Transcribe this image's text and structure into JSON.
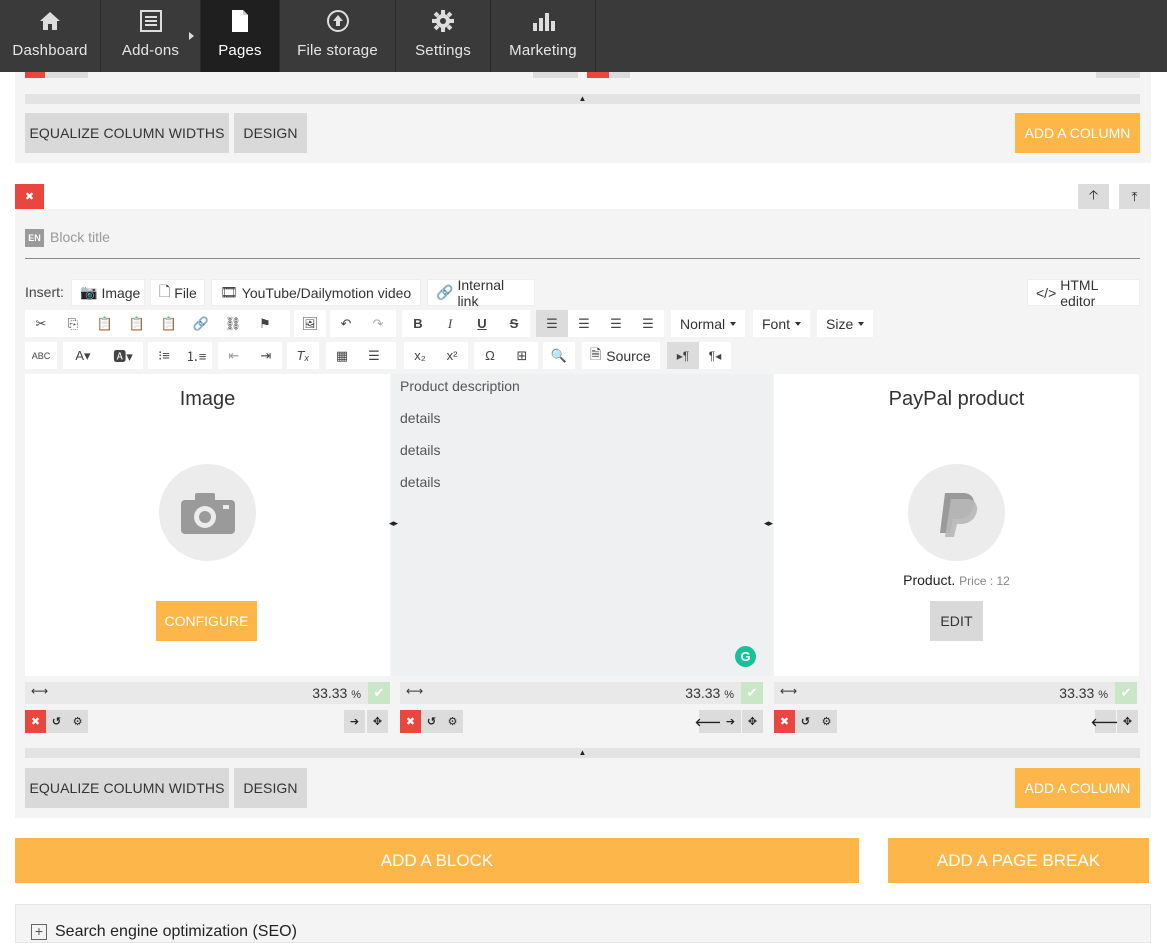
{
  "nav": {
    "dashboard": "Dashboard",
    "addons": "Add-ons",
    "pages": "Pages",
    "file_storage": "File storage",
    "settings": "Settings",
    "marketing": "Marketing"
  },
  "row_actions": {
    "equalize": "EQUALIZE COLUMN WIDTHS",
    "design": "DESIGN",
    "add_column": "ADD A COLUMN"
  },
  "block": {
    "lang": "EN",
    "title_placeholder": "Block title"
  },
  "insert": {
    "label": "Insert:",
    "image": "Image",
    "file": "File",
    "video": "YouTube/Dailymotion video",
    "internal_link": "Internal link",
    "html_editor": "HTML editor"
  },
  "toolbar": {
    "format": "Normal",
    "font": "Font",
    "size": "Size",
    "source": "Source"
  },
  "columns": [
    {
      "title": "Image",
      "button": "CONFIGURE",
      "width": "33.33",
      "unit": "%"
    },
    {
      "lines": [
        "Product description",
        "details",
        "details",
        "details"
      ],
      "width": "33.33",
      "unit": "%"
    },
    {
      "title": "PayPal product",
      "product_name": "Product.",
      "price": "Price : 12",
      "button": "EDIT",
      "width": "33.33",
      "unit": "%"
    }
  ],
  "add_block": "ADD A BLOCK",
  "add_page_break": "ADD A PAGE BREAK",
  "seo": "Search engine optimization (SEO)",
  "colors": {
    "accent": "#fdb64a",
    "danger": "#e8463f",
    "nav_bg": "#3a3a3a"
  }
}
